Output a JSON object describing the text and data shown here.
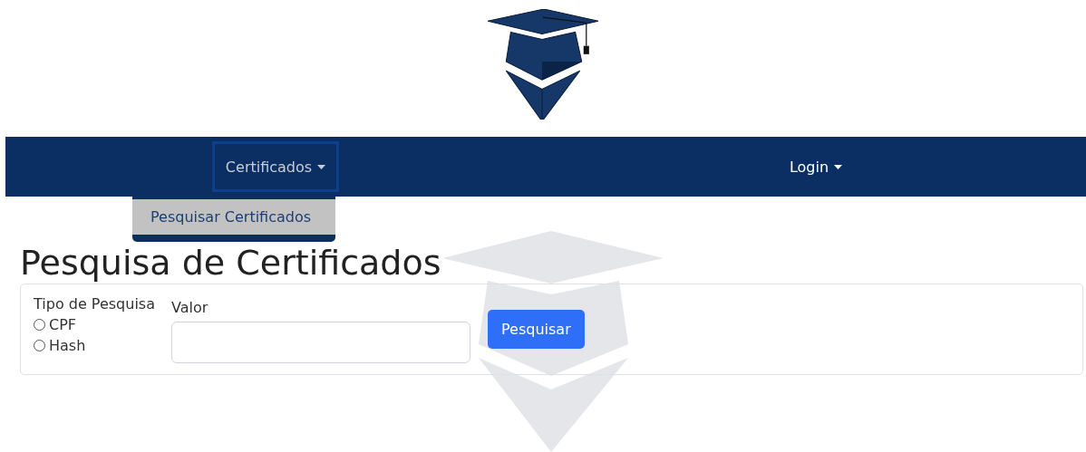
{
  "navbar": {
    "items": [
      {
        "label": "Certificados",
        "caret": true,
        "expanded": true,
        "menu": [
          {
            "label": "Pesquisar Certificados",
            "selected": true
          }
        ]
      },
      {
        "label": "Login",
        "caret": true,
        "expanded": false
      }
    ]
  },
  "page": {
    "title": "Pesquisa de Certificados"
  },
  "search_form": {
    "type_label": "Tipo de Pesquisa",
    "options": [
      {
        "label": "CPF",
        "selected": false
      },
      {
        "label": "Hash",
        "selected": false
      }
    ],
    "value_label": "Valor",
    "button": "Pesquisar"
  }
}
